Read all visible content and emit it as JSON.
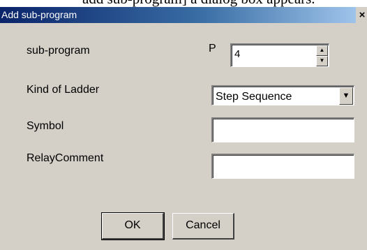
{
  "document": {
    "background_text": "add sub-program] a dialog box appears."
  },
  "dialog": {
    "title": "Add sub-program",
    "close_label": "×",
    "subprogram": {
      "label": "sub-program",
      "prefix": "P",
      "value": "4",
      "up_glyph": "▲",
      "down_glyph": "▼"
    },
    "kind_of_ladder": {
      "label": "Kind of Ladder",
      "selected": "Step Sequence",
      "arrow_glyph": "▼"
    },
    "symbol": {
      "label": "Symbol",
      "value": ""
    },
    "relay_comment": {
      "label": "RelayComment",
      "value": ""
    },
    "buttons": {
      "ok": "OK",
      "cancel": "Cancel"
    }
  }
}
